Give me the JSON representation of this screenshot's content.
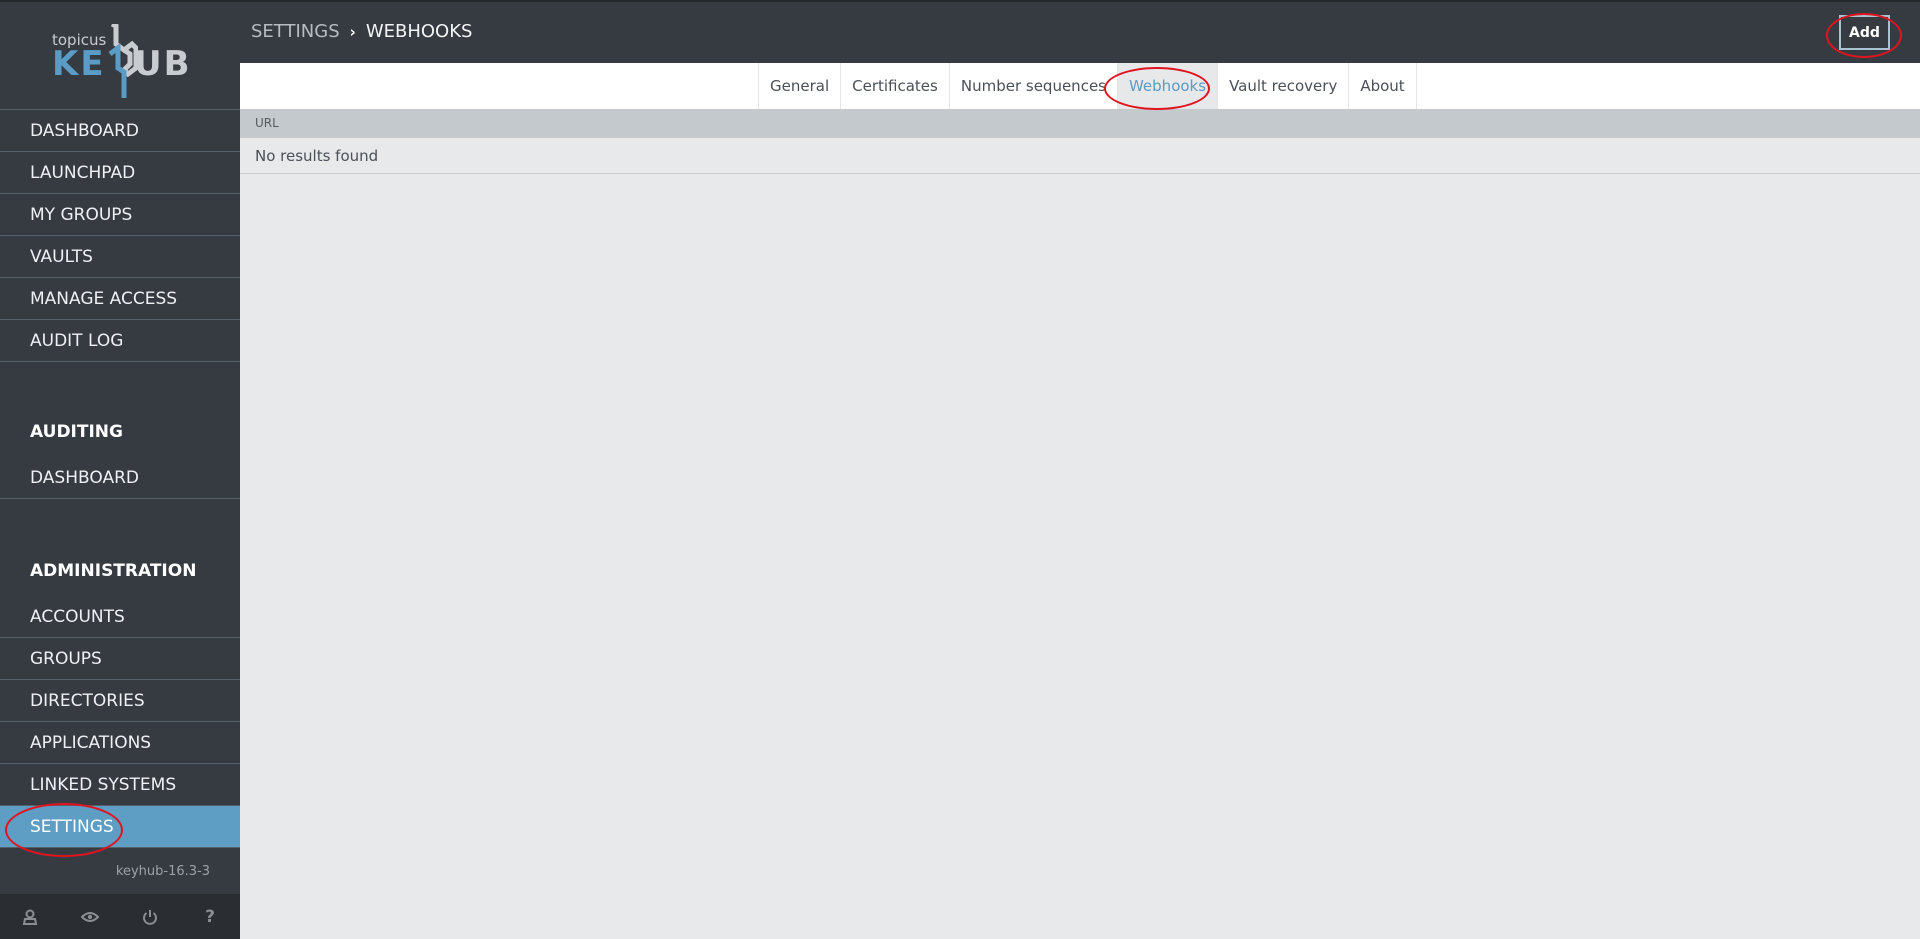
{
  "app": {
    "logo_small": "topicus",
    "logo_key": "KE",
    "logo_hub": "UB",
    "version": "keyhub-16.3-3"
  },
  "header": {
    "breadcrumb": [
      "SETTINGS",
      "WEBHOOKS"
    ],
    "breadcrumb_separator": "›",
    "add_label": "Add"
  },
  "sidebar": {
    "main_items": [
      {
        "label": "DASHBOARD"
      },
      {
        "label": "LAUNCHPAD"
      },
      {
        "label": "MY GROUPS"
      },
      {
        "label": "VAULTS"
      },
      {
        "label": "MANAGE ACCESS"
      },
      {
        "label": "AUDIT LOG"
      }
    ],
    "auditing": {
      "heading": "AUDITING",
      "items": [
        {
          "label": "DASHBOARD"
        }
      ]
    },
    "administration": {
      "heading": "ADMINISTRATION",
      "items": [
        {
          "label": "ACCOUNTS"
        },
        {
          "label": "GROUPS"
        },
        {
          "label": "DIRECTORIES"
        },
        {
          "label": "APPLICATIONS"
        },
        {
          "label": "LINKED SYSTEMS"
        },
        {
          "label": "SETTINGS",
          "active": true
        }
      ]
    },
    "bottom_icons": [
      "user-icon",
      "eye-icon",
      "power-icon",
      "help-icon"
    ],
    "help_glyph": "?"
  },
  "tabs": [
    {
      "label": "General"
    },
    {
      "label": "Certificates"
    },
    {
      "label": "Number sequences"
    },
    {
      "label": "Webhooks",
      "active": true
    },
    {
      "label": "Vault recovery"
    },
    {
      "label": "About"
    }
  ],
  "table": {
    "columns": [
      "URL"
    ],
    "empty_message": "No results found"
  },
  "colors": {
    "sidebar_bg": "#363b42",
    "active_accent": "#5e9dc4",
    "annotation": "#e0141e"
  }
}
